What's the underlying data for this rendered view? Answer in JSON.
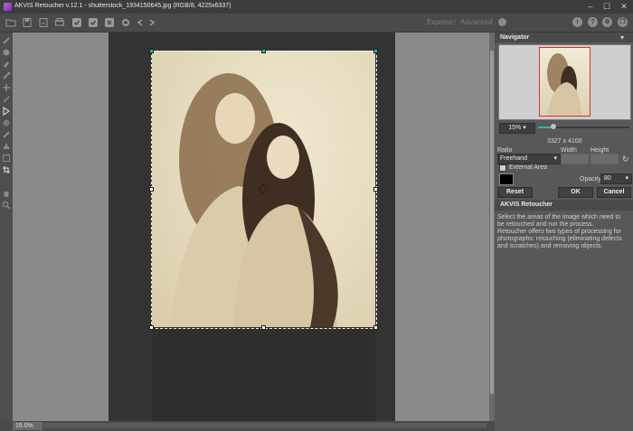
{
  "window": {
    "title": "AKVIS Retoucher v.12.1 - shutterstock_1934150645.jpg (RGB/8, 4225x6337)",
    "minimize": "‒",
    "maximize": "☐",
    "close": "✕"
  },
  "toolbar": {
    "icons": [
      "open-icon",
      "save-icon",
      "save-as-icon",
      "print-icon",
      "run-icon",
      "apply-icon",
      "cancel-icon",
      "settings-icon",
      "undo-icon",
      "redo-icon"
    ],
    "mode_express": "Express",
    "mode_sep": "|",
    "mode_advanced": "Advanced",
    "right_icons": [
      "i",
      "?",
      "⚙",
      "❐"
    ]
  },
  "tools": [
    "brush-icon",
    "shape-icon",
    "eraser-icon",
    "tube-icon",
    "pencil-icon",
    "selection-arrow-icon",
    "bucket-icon",
    "chisel-icon",
    "history-brush-icon",
    "stamp-icon",
    "patch-icon",
    "crop-icon",
    "hand-icon",
    "zoom-icon"
  ],
  "status": {
    "zoom": "15.0%"
  },
  "navigator": {
    "title": "Navigator",
    "menu": "▾",
    "zoom_value": "15%",
    "dimensions": "3327 x 4100"
  },
  "crop": {
    "ratio_label": "Ratio",
    "ratio_value": "Freehand",
    "width_label": "Width",
    "height_label": "Height",
    "width_value": "",
    "height_value": "",
    "external_area_label": "External Area",
    "external_area_checked": true,
    "external_color": "#000000",
    "opacity_label": "Opacity",
    "opacity_value": "80",
    "reset_label": "Reset",
    "ok_label": "OK",
    "cancel_label": "Cancel"
  },
  "help": {
    "title": "AKVIS Retoucher",
    "para1": "Select the areas of the image which need to be retouched and run the process.",
    "para2": "Retoucher offers two types of processing for photographs: retouching (eliminating defects and scratches) and removing objects."
  },
  "colors": {
    "accent_teal": "#2bb6b0",
    "nav_frame": "#d23232"
  }
}
